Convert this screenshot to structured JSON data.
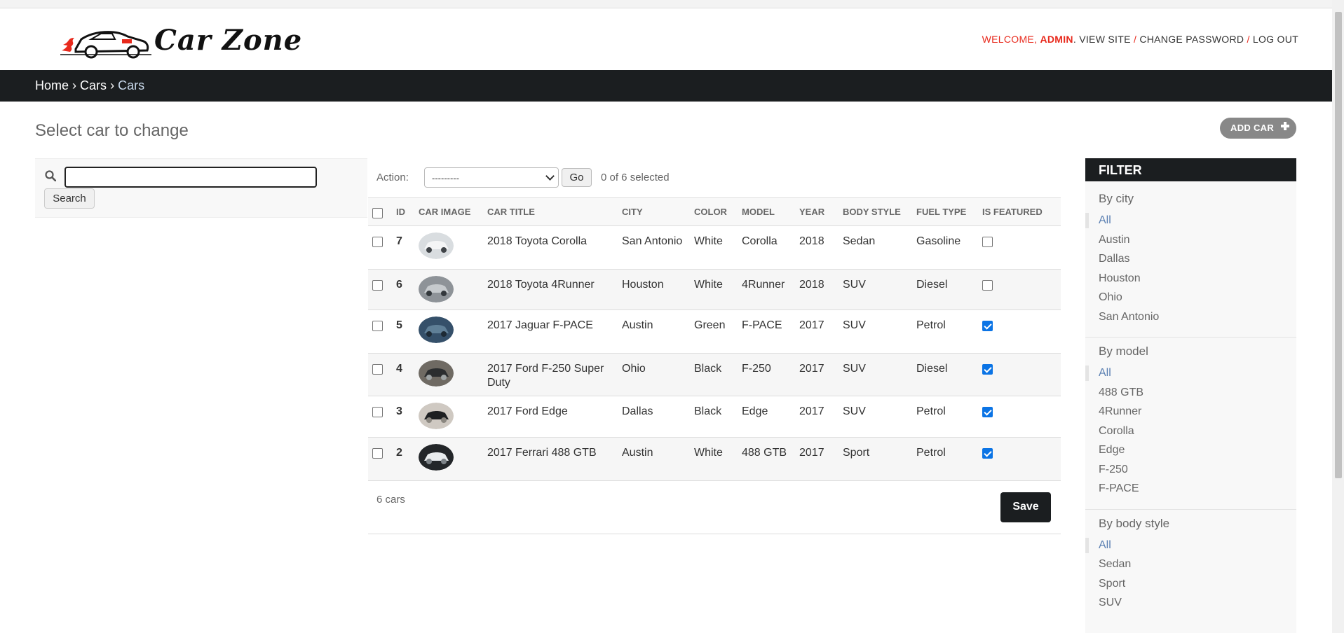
{
  "header": {
    "brand": "Car Zone",
    "welcome": "WELCOME,",
    "user": "ADMIN",
    "view_site": "VIEW SITE",
    "change_password": "CHANGE PASSWORD",
    "log_out": "LOG OUT",
    "separator": "/"
  },
  "breadcrumbs": {
    "home": "Home",
    "app": "Cars",
    "current": "Cars",
    "sep": "›"
  },
  "page": {
    "title": "Select car to change",
    "add_label": "ADD CAR"
  },
  "search": {
    "value": "",
    "button": "Search"
  },
  "actions": {
    "label": "Action:",
    "selected_option": "---------",
    "go": "Go",
    "selection": "0 of 6 selected"
  },
  "table": {
    "columns": [
      "ID",
      "CAR IMAGE",
      "CAR TITLE",
      "CITY",
      "COLOR",
      "MODEL",
      "YEAR",
      "BODY STYLE",
      "FUEL TYPE",
      "IS FEATURED"
    ],
    "rows": [
      {
        "id": "7",
        "title": "2018 Toyota Corolla",
        "city": "San Antonio",
        "color": "White",
        "model": "Corolla",
        "year": "2018",
        "body": "Sedan",
        "fuel": "Gasoline",
        "featured": false,
        "image": "white-sedan"
      },
      {
        "id": "6",
        "title": "2018 Toyota 4Runner",
        "city": "Houston",
        "color": "White",
        "model": "4Runner",
        "year": "2018",
        "body": "SUV",
        "fuel": "Diesel",
        "featured": false,
        "image": "silver-suv"
      },
      {
        "id": "5",
        "title": "2017 Jaguar F-PACE",
        "city": "Austin",
        "color": "Green",
        "model": "F-PACE",
        "year": "2017",
        "body": "SUV",
        "fuel": "Petrol",
        "featured": true,
        "image": "green-suv"
      },
      {
        "id": "4",
        "title": "2017 Ford F-250 Super Duty",
        "city": "Ohio",
        "color": "Black",
        "model": "F-250",
        "year": "2017",
        "body": "SUV",
        "fuel": "Diesel",
        "featured": true,
        "image": "black-truck"
      },
      {
        "id": "3",
        "title": "2017 Ford Edge",
        "city": "Dallas",
        "color": "Black",
        "model": "Edge",
        "year": "2017",
        "body": "SUV",
        "fuel": "Petrol",
        "featured": true,
        "image": "black-suv"
      },
      {
        "id": "2",
        "title": "2017 Ferrari 488 GTB",
        "city": "Austin",
        "color": "White",
        "model": "488 GTB",
        "year": "2017",
        "body": "Sport",
        "fuel": "Petrol",
        "featured": true,
        "image": "white-sport"
      }
    ],
    "count": "6 cars",
    "save": "Save"
  },
  "filter": {
    "title": "FILTER",
    "groups": [
      {
        "title": "By city",
        "items": [
          "All",
          "Austin",
          "Dallas",
          "Houston",
          "Ohio",
          "San Antonio"
        ]
      },
      {
        "title": "By model",
        "items": [
          "All",
          "488 GTB",
          "4Runner",
          "Corolla",
          "Edge",
          "F-250",
          "F-PACE"
        ]
      },
      {
        "title": "By body style",
        "items": [
          "All",
          "Sedan",
          "Sport",
          "SUV"
        ]
      }
    ]
  },
  "colors": {
    "accent_red": "#e8291c",
    "dark_bar": "#1b1e20",
    "link_blue": "#5b80b2",
    "checkbox_blue": "#0b74e5"
  }
}
